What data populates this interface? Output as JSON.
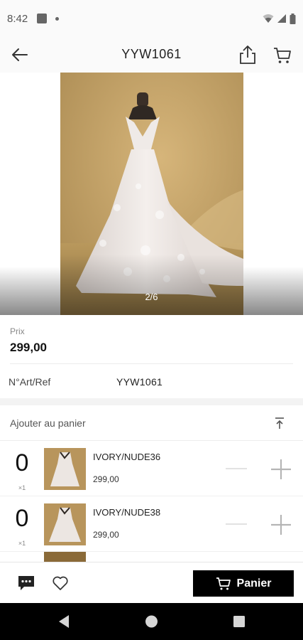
{
  "status_bar": {
    "time": "8:42"
  },
  "header": {
    "title": "YYW1061"
  },
  "gallery": {
    "counter": "2/6"
  },
  "product": {
    "price_label": "Prix",
    "price": "299,00",
    "ref_label": "N°Art/Ref",
    "ref_value": "YYW1061"
  },
  "cart_section": {
    "title": "Ajouter au panier",
    "variants": [
      {
        "qty": "0",
        "step": "×1",
        "name": "IVORY/NUDE36",
        "price": "299,00"
      },
      {
        "qty": "0",
        "step": "×1",
        "name": "IVORY/NUDE38",
        "price": "299,00"
      }
    ]
  },
  "action_bar": {
    "cart_button": "Panier"
  },
  "colors": {
    "accent": "#000000",
    "wall": "#c8a66c",
    "dress": "#efe9e6"
  }
}
